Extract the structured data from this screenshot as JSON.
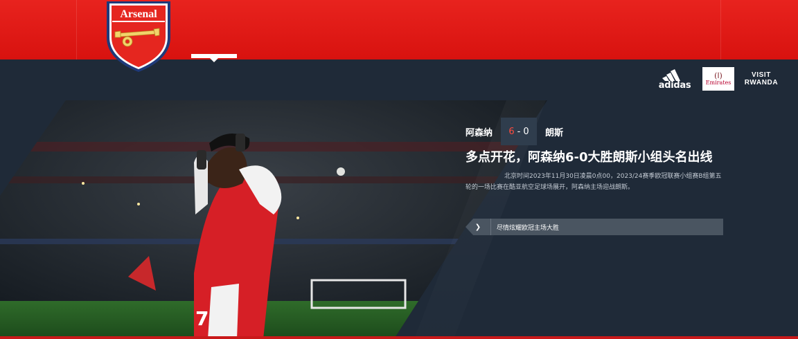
{
  "brand": {
    "wordmark": "Arsenal",
    "primary_color": "#e8231e",
    "navy": "#1f2a38"
  },
  "sponsors": {
    "adidas": "adidas",
    "emirates_mark": "(ا)",
    "emirates_label": "Emirates",
    "visit_rwanda_line1": "VISIT",
    "visit_rwanda_line2": "RWANDA"
  },
  "match": {
    "home_team": "阿森纳",
    "away_team": "朗斯",
    "home_score": "6",
    "separator": "-",
    "away_score": "0"
  },
  "article": {
    "headline": "多点开花，阿森纳6-0大胜朗斯小组头名出线",
    "summary": "北京时间2023年11月30日凌晨0点00，2023/24赛季欧冠联赛小组赛B组第五轮的一场比赛在酷亚航空足球场展开，阿森纳主场迎战朗斯。",
    "cta_arrow": "❯",
    "cta_label": "尽情炫耀欧冠主场大胜"
  },
  "player": {
    "shirt_number": "7"
  },
  "icons": {
    "crest": "arsenal-crest-icon",
    "cannon": "cannon-icon",
    "arrow": "chevron-right-icon"
  }
}
